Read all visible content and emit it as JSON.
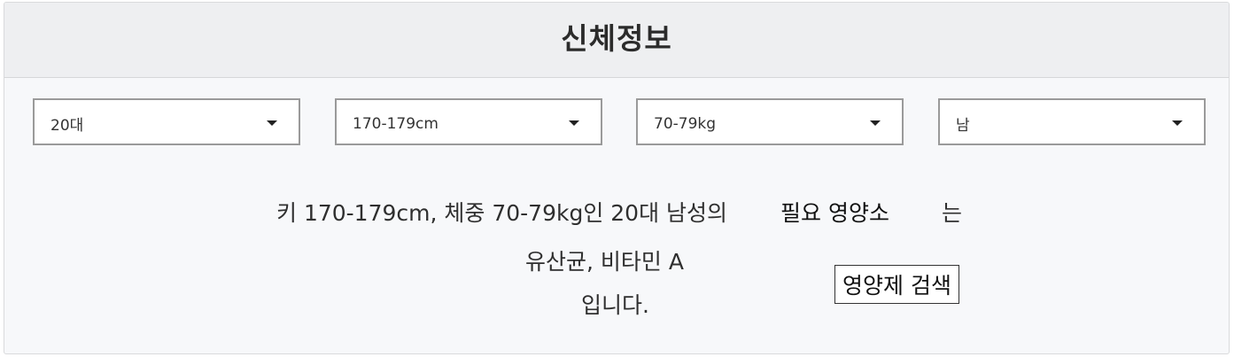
{
  "panel": {
    "title": "신체정보"
  },
  "filters": {
    "age": {
      "selected": "20대"
    },
    "height": {
      "selected": "170-179cm"
    },
    "weight": {
      "selected": "70-79kg"
    },
    "gender": {
      "selected": "남"
    }
  },
  "result": {
    "line1": "키 170-179cm, 체중 70-79kg인 20대 남성의",
    "highlight": "필요 영양소",
    "suffix": "는",
    "nutrients": "유산균, 비타민 A",
    "ending": "입니다."
  },
  "actions": {
    "search_label": "영양제 검색"
  },
  "icons": {
    "dropdown": "caret-down-icon"
  },
  "colors": {
    "panel_bg": "#f7f8fa",
    "header_bg": "#eeeff1",
    "select_border": "#9a9a9a"
  }
}
